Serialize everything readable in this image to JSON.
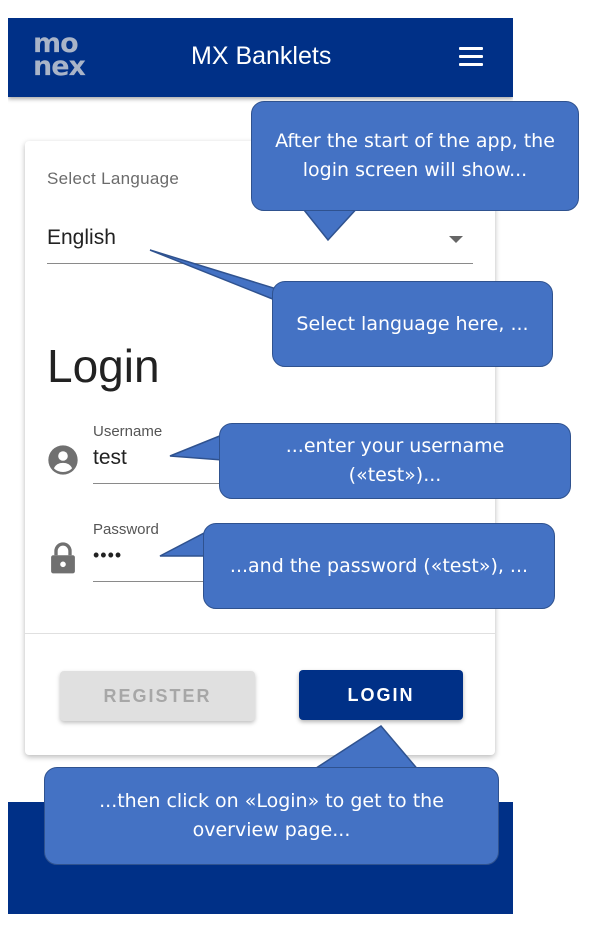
{
  "app": {
    "title": "MX Banklets",
    "logo_line1": "mo",
    "logo_line2": "nex",
    "bottom_text": ","
  },
  "language": {
    "label": "Select Language",
    "value": "English"
  },
  "login": {
    "heading": "Login",
    "username_label": "Username",
    "username_value": "test",
    "password_label": "Password",
    "password_value": "••••",
    "register_button": "REGISTER",
    "login_button": "LOGIN"
  },
  "callouts": {
    "start": "After the start of the app, the login screen will show...",
    "language": "Select language here, ...",
    "username": "...enter your username («test»)...",
    "password": "...and the password («test»), ...",
    "login": "...then click on «Login» to get to the overview page..."
  },
  "colors": {
    "primary": "#003087",
    "callout": "#4472c4",
    "callout_border": "#2f528f"
  },
  "icons": {
    "menu": "menu-icon",
    "user": "account-circle-icon",
    "password": "lock-icon",
    "dropdown": "dropdown-arrow-icon"
  }
}
